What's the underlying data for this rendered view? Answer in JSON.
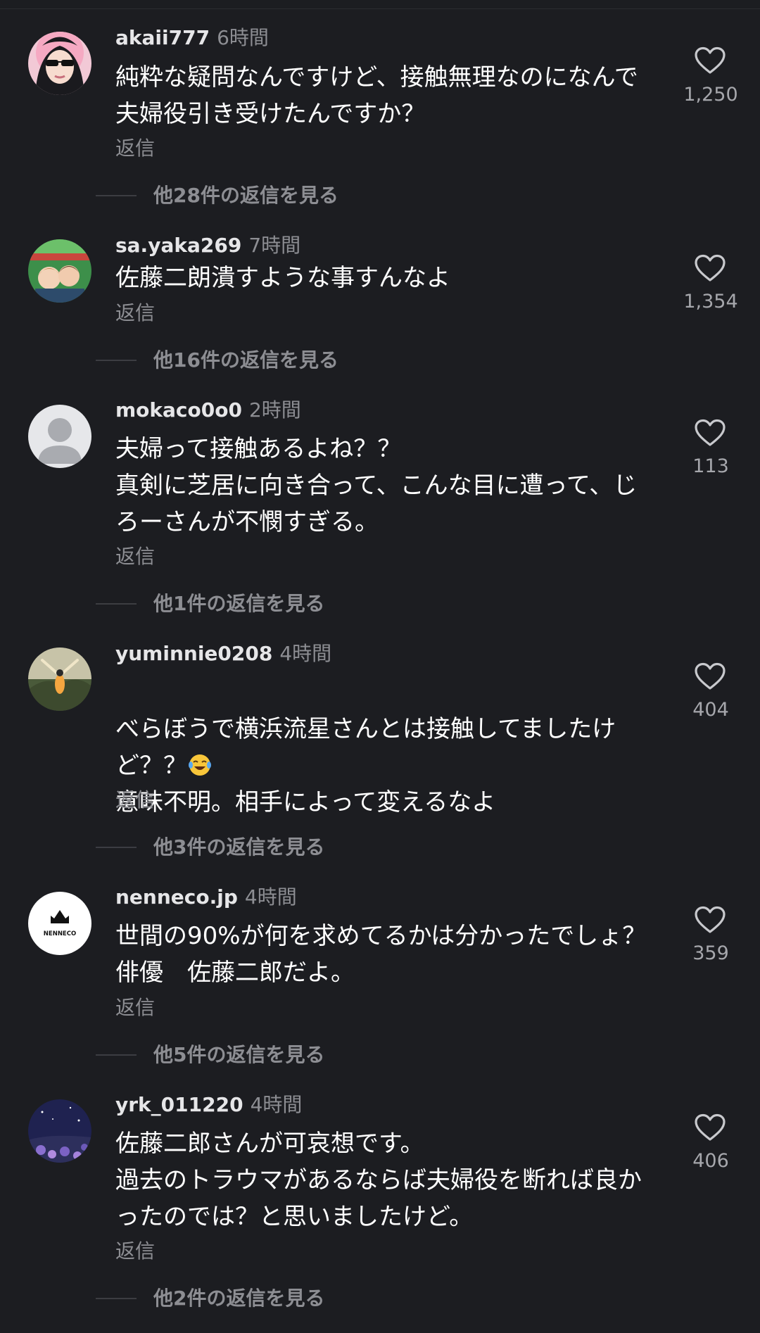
{
  "reply_label": "返信",
  "comments": [
    {
      "username": "akaii777",
      "time": "6時間",
      "text": "純粋な疑問なんですけど、接触無理なのになんで\n夫婦役引き受けたんですか？",
      "likes": "1,250",
      "view_replies": "他28件の返信を見る"
    },
    {
      "username": "sa.yaka269",
      "time": "7時間",
      "text": "佐藤二朗潰すような事すんなよ",
      "likes": "1,354",
      "view_replies": "他16件の返信を見る"
    },
    {
      "username": "mokaco0o0",
      "time": "2時間",
      "text": "夫婦って接触あるよね？？\n真剣に芝居に向き合って、こんな目に遭って、じ\nろーさんが不憫すぎる。",
      "likes": "113",
      "view_replies": "他1件の返信を見る"
    },
    {
      "username": "yuminnie0208",
      "time": "4時間",
      "text_line1": "べらぼうで横浜流星さんとは接触してましたけ",
      "text_line2": "ど？？",
      "text_line3": "意味不明。相手によって変えるなよ",
      "emoji": "laughing-crying",
      "likes": "404",
      "view_replies": "他3件の返信を見る"
    },
    {
      "username": "nenneco.jp",
      "time": "4時間",
      "text": "世間の90%が何を求めてるかは分かったでしょ？\n俳優　佐藤二郎だよ。",
      "likes": "359",
      "view_replies": "他5件の返信を見る",
      "avatar_text": "NENNECO"
    },
    {
      "username": "yrk_011220",
      "time": "4時間",
      "text": "佐藤二郎さんが可哀想です。\n過去のトラウマがあるならば夫婦役を断れば良か\nったのでは？と思いましたけど。",
      "likes": "406",
      "view_replies": "他2件の返信を見る"
    }
  ],
  "colors": {
    "background": "#1c1d21",
    "username": "#e6e6e8",
    "secondary": "#8d8e93",
    "text": "#ffffff"
  }
}
